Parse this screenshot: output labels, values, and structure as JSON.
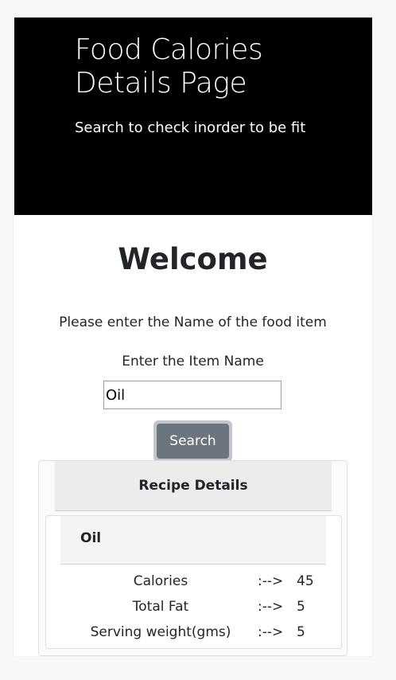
{
  "hero": {
    "title_line1": "Food Calories",
    "title_line2": "Details Page",
    "subtitle": "Search to check inorder to be fit"
  },
  "main": {
    "welcome": "Welcome",
    "prompt": "Please enter the Name of the food item",
    "item_label": "Enter the Item Name",
    "item_value": "Oil",
    "search_label": "Search"
  },
  "recipe": {
    "header": "Recipe Details",
    "name": "Oil",
    "separator": ":-->",
    "rows": [
      {
        "label": "Calories",
        "value": "45"
      },
      {
        "label": "Total Fat",
        "value": "5"
      },
      {
        "label": "Serving weight(gms)",
        "value": "5"
      }
    ]
  }
}
